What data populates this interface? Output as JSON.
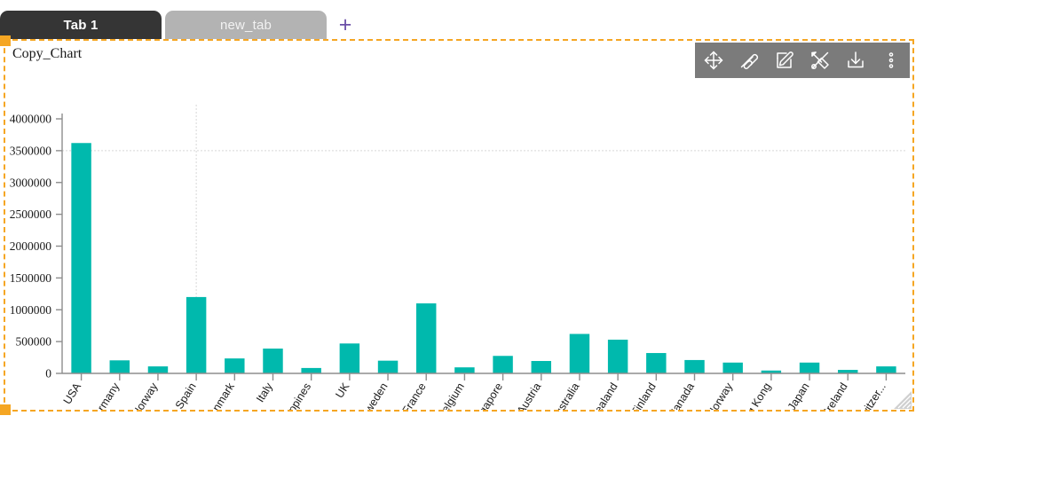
{
  "tabs": [
    {
      "label": "Tab 1",
      "active": true
    },
    {
      "label": "new_tab",
      "active": false
    }
  ],
  "add_tab_label": "+",
  "widget": {
    "title": "Copy_Chart"
  },
  "toolbar": {
    "items": [
      {
        "name": "move-icon",
        "title": "Move"
      },
      {
        "name": "scribble-icon",
        "title": "Draw"
      },
      {
        "name": "edit-pencil-icon",
        "title": "Edit"
      },
      {
        "name": "tools-icon",
        "title": "Tools"
      },
      {
        "name": "download-icon",
        "title": "Download"
      },
      {
        "name": "more-vertical-icon",
        "title": "More"
      }
    ]
  },
  "colors": {
    "bar": "#00b9ad",
    "selection_border": "#f5a623",
    "toolbar_bg": "#7b7b7b",
    "active_tab": "#353535",
    "inactive_tab": "#b3b3b3",
    "add_tab": "#6b4fa8",
    "canvas": "#dedede",
    "axis": "#8d8d8d",
    "crosshair": "#d7d7d7"
  },
  "chart_data": {
    "type": "bar",
    "title": "Copy_Chart",
    "xlabel": "",
    "ylabel": "",
    "ylim": [
      0,
      4000000
    ],
    "ytick_values": [
      0,
      500000,
      1000000,
      1500000,
      2000000,
      2500000,
      3000000,
      3500000,
      4000000
    ],
    "ytick_labels": [
      "0",
      "500000",
      "1000000",
      "1500000",
      "2000000",
      "2500000",
      "3000000",
      "3500000",
      "4000000"
    ],
    "grid": false,
    "legend": false,
    "categories": [
      "USA",
      "Germany",
      "Norway",
      "Spain",
      "Denmark",
      "Italy",
      "Philippines",
      "UK",
      "Sweden",
      "France",
      "Belgium",
      "Singapore",
      "Austria",
      "Australia",
      "New Zealand",
      "Finland",
      "Canada",
      "Norway",
      "Hong Kong",
      "Japan",
      "Ireland",
      "Switzer..."
    ],
    "values": [
      3620000,
      205000,
      110000,
      1200000,
      235000,
      390000,
      85000,
      470000,
      200000,
      1100000,
      95000,
      275000,
      195000,
      620000,
      530000,
      320000,
      210000,
      170000,
      45000,
      170000,
      55000,
      110000
    ],
    "annotations": [
      {
        "type": "crosshair-horizontal",
        "value": 3500000
      },
      {
        "type": "crosshair-vertical",
        "category": "Spain"
      }
    ]
  }
}
